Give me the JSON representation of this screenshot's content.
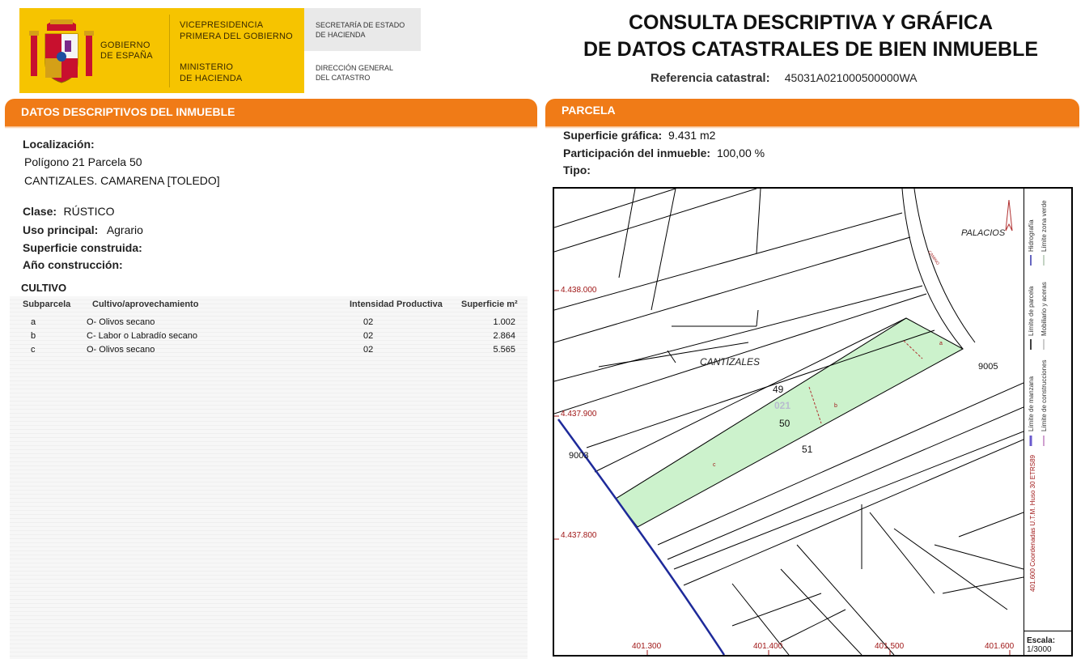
{
  "logo": {
    "gobierno": [
      "GOBIERNO",
      "DE ESPAÑA"
    ],
    "vicepresidencia": [
      "VICEPRESIDENCIA",
      "PRIMERA DEL GOBIERNO"
    ],
    "ministerio": [
      "MINISTERIO",
      "DE HACIENDA"
    ],
    "secretaria": [
      "SECRETARÍA DE ESTADO",
      "DE HACIENDA"
    ],
    "direccion": [
      "DIRECCIÓN GENERAL",
      "DEL CATASTRO"
    ]
  },
  "header": {
    "title_line1": "CONSULTA DESCRIPTIVA Y GRÁFICA",
    "title_line2": "DE DATOS CATASTRALES DE BIEN INMUEBLE",
    "ref_label": "Referencia catastral:",
    "ref_value": "45031A021000500000WA"
  },
  "left": {
    "section_title": "DATOS DESCRIPTIVOS DEL INMUEBLE",
    "localizacion_label": "Localización:",
    "localizacion_line1": "Polígono 21 Parcela 50",
    "localizacion_line2": "CANTIZALES. CAMARENA [TOLEDO]",
    "clase_label": "Clase:",
    "clase_value": "RÚSTICO",
    "uso_label": "Uso principal:",
    "uso_value": "Agrario",
    "superficie_label": "Superficie construida:",
    "anio_label": "Año construcción:"
  },
  "cultivo": {
    "title": "CULTIVO",
    "headers": {
      "subparcela": "Subparcela",
      "cultivo": "Cultivo/aprovechamiento",
      "intensidad": "Intensidad Productiva",
      "superficie": "Superficie m²"
    },
    "rows": [
      {
        "sub": "a",
        "cultivo": "O- Olivos secano",
        "intensidad": "02",
        "superficie": "1.002"
      },
      {
        "sub": "b",
        "cultivo": "C- Labor o Labradío secano",
        "intensidad": "02",
        "superficie": "2.864"
      },
      {
        "sub": "c",
        "cultivo": "O- Olivos secano",
        "intensidad": "02",
        "superficie": "5.565"
      }
    ]
  },
  "right": {
    "section_title": "PARCELA",
    "sup_label": "Superficie gráfica:",
    "sup_value": "9.431 m2",
    "part_label": "Participación del inmueble:",
    "part_value": "100,00 %",
    "tipo_label": "Tipo:"
  },
  "map": {
    "place_palacios": "PALACIOS",
    "place_cantizales": "CANTIZALES",
    "camino": "CAMINO",
    "parcel_49": "49",
    "parcel_50": "50",
    "parcel_51": "51",
    "poligono": "021",
    "num_9005": "9005",
    "num_9003": "9003",
    "sub_a": "a",
    "sub_b": "b",
    "sub_c": "c",
    "y_ticks": [
      "4.438.000",
      "4.437.900",
      "4.437.800"
    ],
    "x_ticks": [
      "401.300",
      "401.400",
      "401.500",
      "401.600"
    ],
    "parcel_fill": "#ccf2cc",
    "coord_color": "#a01818"
  },
  "legend": {
    "items": [
      "Límite de manzana",
      "Límite de construcciones",
      "Límite de parcela",
      "Mobiliario y aceras",
      "Hidrografía",
      "Límite zona verde"
    ],
    "coords_note": "401.600 Coordenadas U.T.M. Huso 30 ETRS89",
    "escala_label": "Escala:",
    "escala_value": "1/3000"
  }
}
